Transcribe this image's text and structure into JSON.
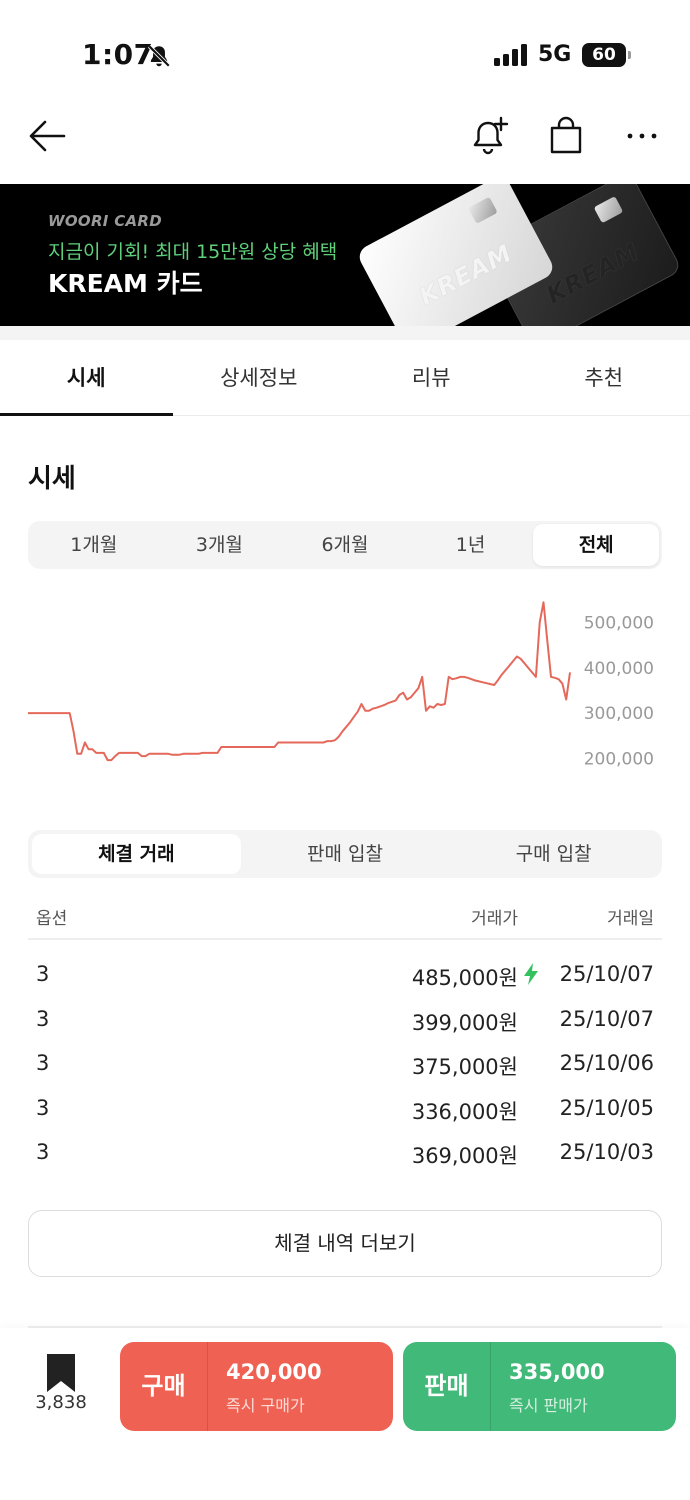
{
  "status_bar": {
    "time": "1:07",
    "network": "5G",
    "battery": "60"
  },
  "banner": {
    "brand": "WOORI CARD",
    "promo": "지금이 기회! 최대 15만원 상당 혜택",
    "title": "KREAM 카드",
    "card_logo": "KREAM"
  },
  "tabs": [
    {
      "label": "시세",
      "active": true
    },
    {
      "label": "상세정보",
      "active": false
    },
    {
      "label": "리뷰",
      "active": false
    },
    {
      "label": "추천",
      "active": false
    }
  ],
  "section_title": "시세",
  "periods": [
    {
      "label": "1개월",
      "active": false
    },
    {
      "label": "3개월",
      "active": false
    },
    {
      "label": "6개월",
      "active": false
    },
    {
      "label": "1년",
      "active": false
    },
    {
      "label": "전체",
      "active": true
    }
  ],
  "chart_data": {
    "type": "line",
    "y_ticks": [
      "500,000",
      "400,000",
      "300,000",
      "200,000"
    ],
    "ylim": [
      130000,
      550000
    ],
    "color": "#e4695b",
    "series": [
      {
        "values": [
          300000,
          300000,
          300000,
          300000,
          300000,
          300000,
          300000,
          300000,
          300000,
          300000,
          300000,
          300000,
          260000,
          210000,
          210000,
          235000,
          220000,
          220000,
          212000,
          212000,
          212000,
          196000,
          196000,
          205000,
          212000,
          212000,
          212000,
          212000,
          212000,
          212000,
          205000,
          205000,
          210000,
          210000,
          210000,
          210000,
          210000,
          210000,
          208000,
          208000,
          208000,
          210000,
          210000,
          210000,
          210000,
          210000,
          212000,
          212000,
          212000,
          212000,
          212000,
          225000,
          225000,
          225000,
          225000,
          225000,
          225000,
          225000,
          225000,
          225000,
          225000,
          225000,
          225000,
          225000,
          225000,
          225000,
          235000,
          235000,
          235000,
          235000,
          235000,
          235000,
          235000,
          235000,
          235000,
          235000,
          235000,
          235000,
          235000,
          238000,
          238000,
          240000,
          248000,
          260000,
          270000,
          280000,
          292000,
          303000,
          320000,
          305000,
          305000,
          310000,
          312000,
          315000,
          318000,
          322000,
          325000,
          328000,
          340000,
          345000,
          330000,
          335000,
          345000,
          355000,
          380000,
          305000,
          315000,
          312000,
          320000,
          318000,
          320000,
          380000,
          375000,
          377000,
          380000,
          380000,
          378000,
          375000,
          372000,
          370000,
          368000,
          366000,
          364000,
          362000,
          373000,
          385000,
          395000,
          405000,
          415000,
          425000,
          420000,
          410000,
          400000,
          390000,
          380000,
          500000,
          545000,
          460000,
          380000,
          378000,
          375000,
          365000,
          330000,
          390000
        ]
      }
    ]
  },
  "trade_tabs": [
    {
      "label": "체결 거래",
      "active": true
    },
    {
      "label": "판매 입찰",
      "active": false
    },
    {
      "label": "구매 입찰",
      "active": false
    }
  ],
  "table": {
    "headers": {
      "option": "옵션",
      "price": "거래가",
      "date": "거래일"
    },
    "rows": [
      {
        "option": "3",
        "price": "485,000원",
        "date": "25/10/07",
        "instant": true
      },
      {
        "option": "3",
        "price": "399,000원",
        "date": "25/10/07",
        "instant": false
      },
      {
        "option": "3",
        "price": "375,000원",
        "date": "25/10/06",
        "instant": false
      },
      {
        "option": "3",
        "price": "336,000원",
        "date": "25/10/05",
        "instant": false
      },
      {
        "option": "3",
        "price": "369,000원",
        "date": "25/10/03",
        "instant": false
      }
    ]
  },
  "more_button": "체결 내역 더보기",
  "bottom_bar": {
    "bookmark_count": "3,838",
    "buy": {
      "label": "구매",
      "price": "420,000",
      "sub": "즉시 구매가",
      "color": "#ef6253"
    },
    "sell": {
      "label": "판매",
      "price": "335,000",
      "sub": "즉시 판매가",
      "color": "#41b979"
    }
  }
}
